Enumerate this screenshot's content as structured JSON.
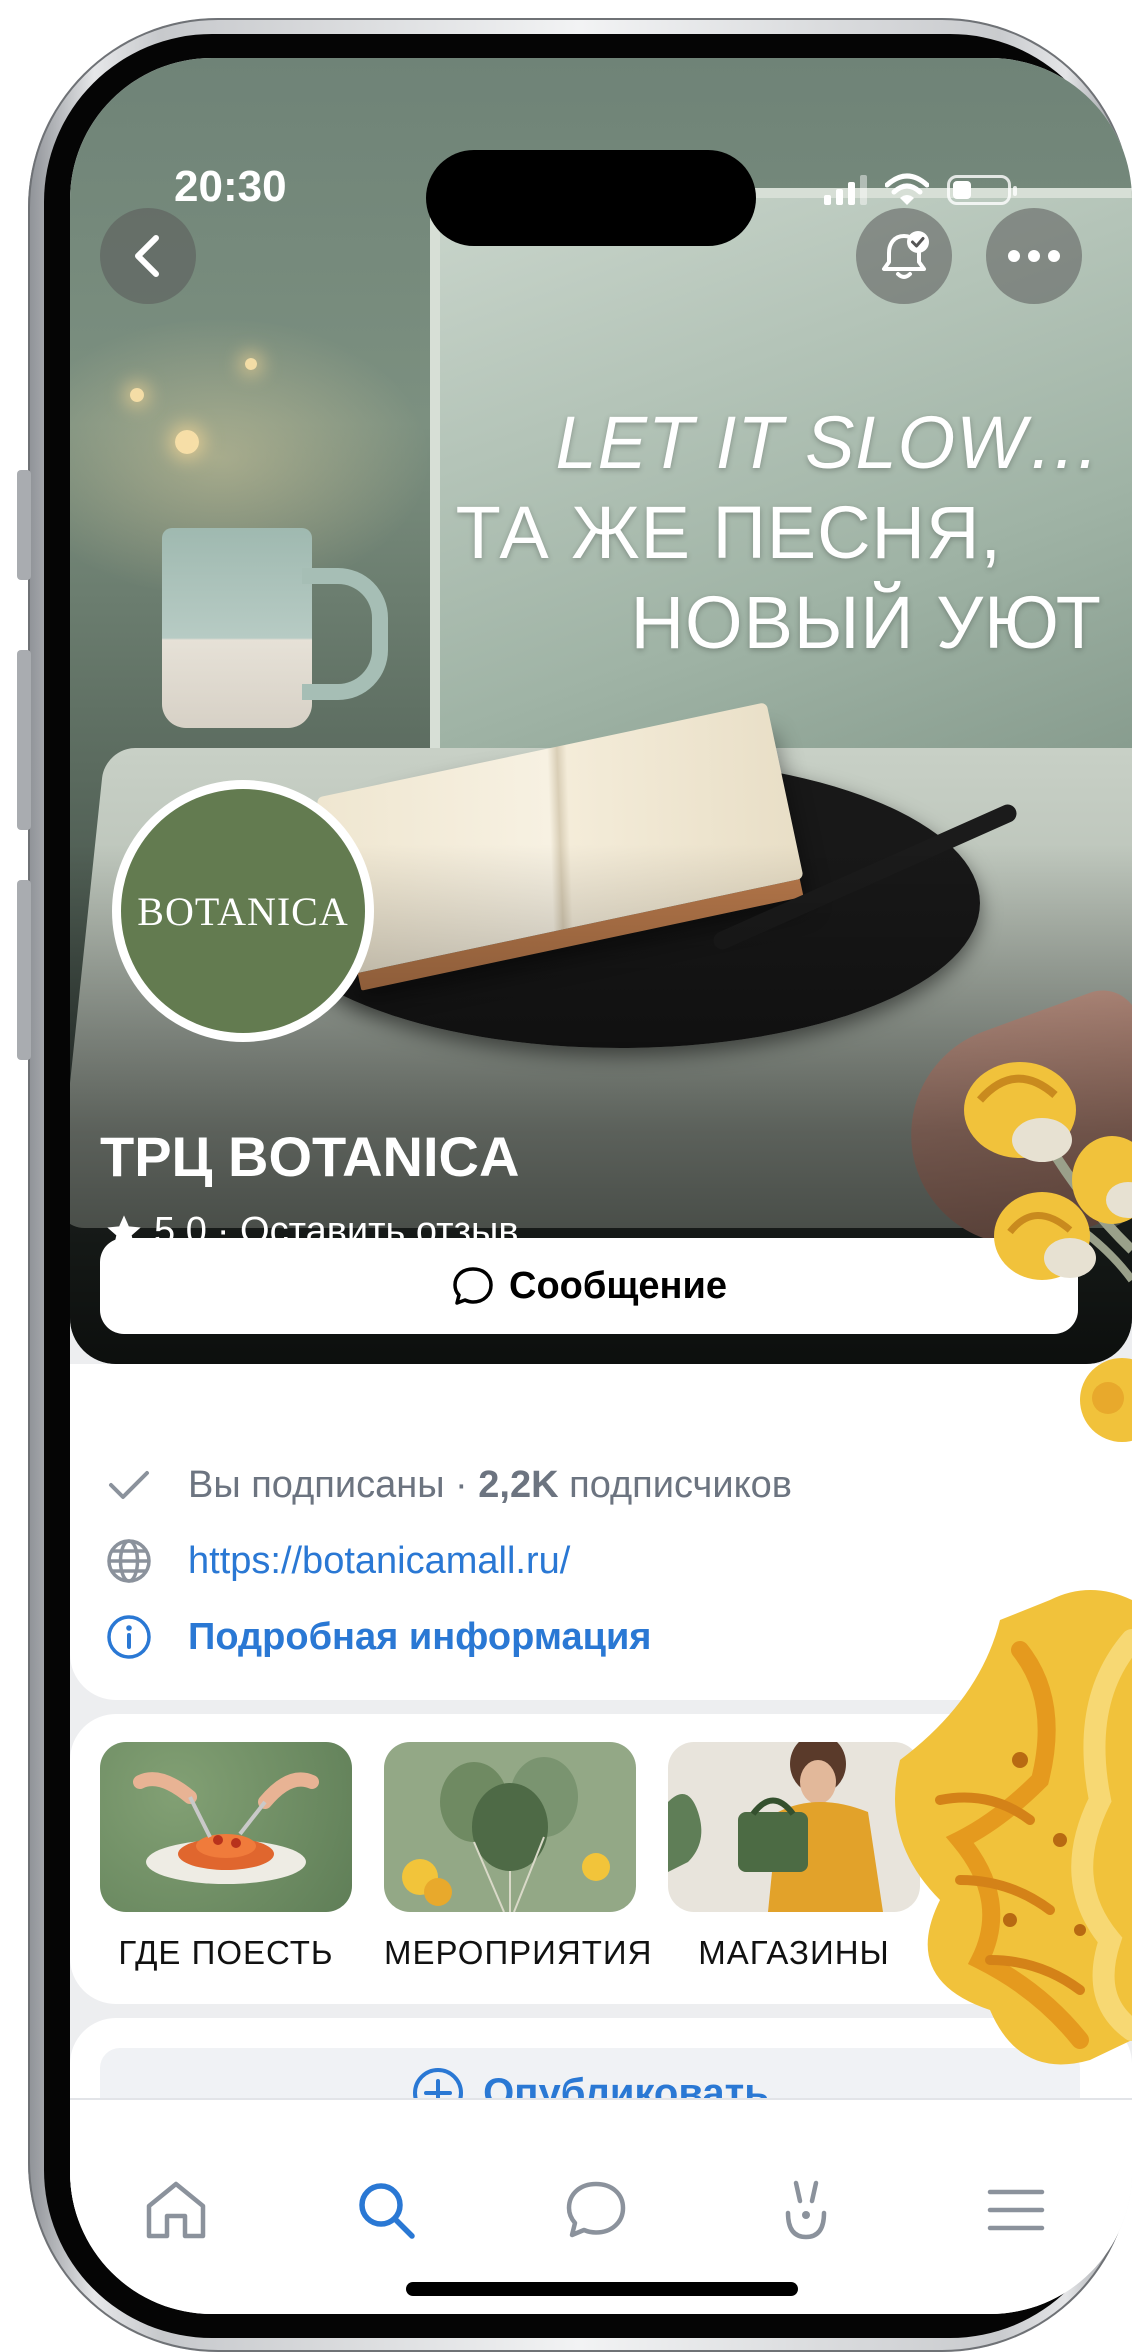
{
  "status_bar": {
    "time": "20:30"
  },
  "hero": {
    "headline": [
      "LET IT SLOW…",
      "ТА ЖЕ ПЕСНЯ,",
      "НОВЫЙ УЮТ"
    ],
    "avatar_text": "BOTANICA"
  },
  "profile": {
    "title": "ТРЦ BOTANICA",
    "rating": "5,0",
    "review_link": "· Оставить отзыв",
    "message_button": "Сообщение"
  },
  "info": {
    "subscribed": "Вы подписаны ·",
    "followers_count": "2,2K",
    "followers_label": "подписчиков",
    "website": "https://botanicamall.ru/",
    "details": "Подробная информация"
  },
  "categories": [
    {
      "label": "ГДЕ ПОЕСТЬ"
    },
    {
      "label": "МЕРОПРИЯТИЯ"
    },
    {
      "label": "МАГАЗИНЫ"
    }
  ],
  "publish": {
    "label": "Опубликовать"
  },
  "bottom_nav": {
    "items": [
      "home-icon",
      "search-icon",
      "messages-icon",
      "clips-icon",
      "menu-icon"
    ],
    "active": "search-icon"
  },
  "colors": {
    "accent": "#2a78d4",
    "avatar_green": "#637b50",
    "muted_text": "#6c7480"
  }
}
